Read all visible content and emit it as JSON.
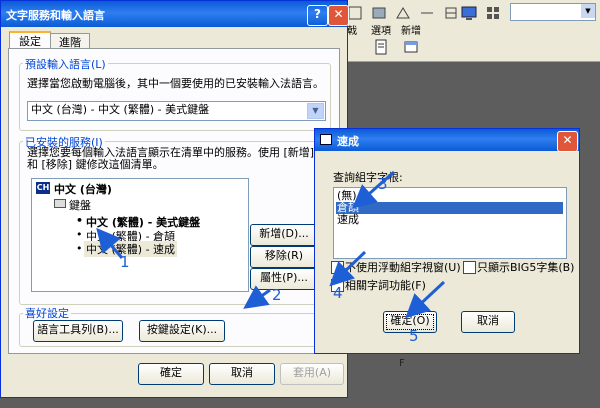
{
  "toolbar": {
    "btn1_label": "選項",
    "btn2_label": "新增",
    "partial_label": "戟"
  },
  "dialog": {
    "title": "文字服務和輸入語言",
    "help_label": "?",
    "close_label": "✕",
    "tabs": [
      "設定",
      "進階"
    ],
    "default_group": "預設輸入語言(L)",
    "default_desc": "選擇當您啟動電腦後，其中一個要使用的已安裝輸入法語言。",
    "default_value": "中文 (台灣) - 中文 (繁體) - 美式鍵盤",
    "installed_group": "已安裝的服務(I)",
    "installed_desc": "選擇您要每個輸入法語言顯示在清單中的服務。使用 [新增] 和 [移除] 鍵修改這個清單。",
    "tree": {
      "lang_badge": "CH",
      "language": "中文 (台灣)",
      "keyboard": "鍵盤",
      "items": [
        "中文 (繁體) - 美式鍵盤",
        "中文 (繁體) - 倉頡",
        "中文 (繁體) - 速成"
      ]
    },
    "add_label": "新增(D)...",
    "remove_label": "移除(R)",
    "props_label": "屬性(P)...",
    "pref_group": "喜好設定",
    "langbar_label": "語言工具列(B)...",
    "keys_label": "按鍵設定(K)...",
    "ok_label": "確定",
    "cancel_label": "取消",
    "apply_label": "套用(A)"
  },
  "subdialog": {
    "title": "速成",
    "close_label": "✕",
    "query_label": "查詢組字字根:",
    "list": [
      "(無)",
      "倉頡",
      "速成"
    ],
    "selected_index": 1,
    "opt1_label": "不使用浮動組字視窗(U)",
    "opt2_label": "只顯示BIG5字集(B)",
    "opt3_label": "相關字詞功能(F)",
    "ok_label": "確定(O)",
    "cancel_label": "取消"
  },
  "annotations": [
    "1",
    "2",
    "3",
    "4",
    "5"
  ],
  "stray_text": "F",
  "colors": {
    "title": "#0a5bd6",
    "accent": "#1f5fd6",
    "group": "#0046d5",
    "selection": "#316ac5"
  }
}
